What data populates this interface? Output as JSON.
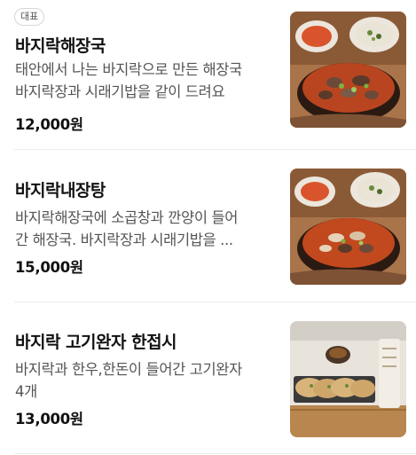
{
  "items": [
    {
      "badge": "대표",
      "name": "바지락해장국",
      "desc_lines": [
        "태안에서 나는 바지락으로 만든 해장국",
        "바지락장과 시래기밥을 같이 드려요"
      ],
      "price": "12,000원"
    },
    {
      "name": "바지락내장탕",
      "desc_lines": [
        "바지락해장국에 소곱창과 깐양이 들어",
        "간 해장국. 바지락장과 시래기밥을 ..."
      ],
      "price": "15,000원"
    },
    {
      "name": "바지락 고기완자 한접시",
      "desc_lines": [
        "바지락과 한우,한돈이 들어간 고기완자",
        "4개"
      ],
      "price": "13,000원"
    }
  ]
}
